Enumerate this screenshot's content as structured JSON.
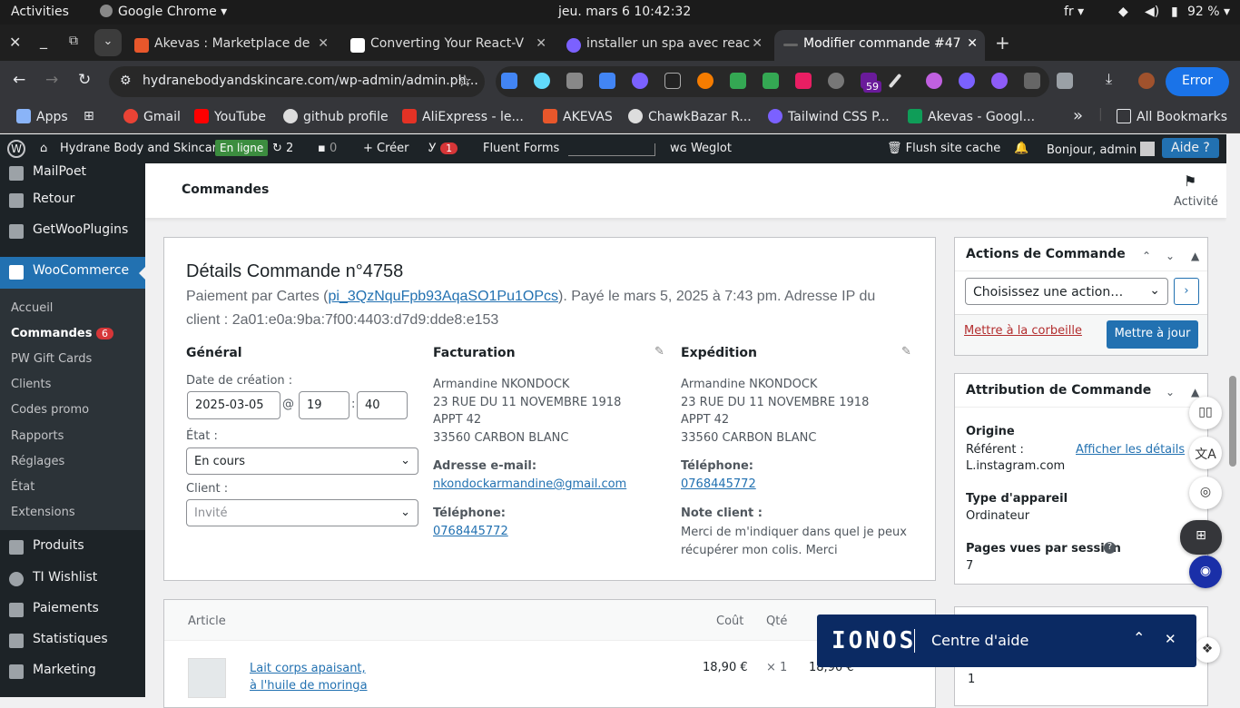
{
  "gnome": {
    "activities": "Activities",
    "app": "Google Chrome",
    "clock": "jeu. mars 6  10:42:32",
    "lang": "fr",
    "battery": "92 %"
  },
  "tabs": [
    {
      "title": "Akevas : Marketplace de",
      "color": "#e8572b"
    },
    {
      "title": "Converting Your React-V",
      "color": "#fff"
    },
    {
      "title": "installer un spa avec reac",
      "color": "#7b61ff"
    },
    {
      "title": "Modifier commande #47",
      "color": "#666"
    }
  ],
  "toolbar": {
    "url": "hydranebodyandskincare.com/wp-admin/admin.ph...",
    "ext_badge": "59",
    "error_label": "Error"
  },
  "bookmarks": [
    {
      "label": "Apps",
      "color": "#8ab4f8"
    },
    {
      "label": "Gmail",
      "color": "#ea4335"
    },
    {
      "label": "YouTube",
      "color": "#ff0000"
    },
    {
      "label": "github profile",
      "color": "#ddd"
    },
    {
      "label": "AliExpress - le...",
      "color": "#e43225"
    },
    {
      "label": "AKEVAS",
      "color": "#e8572b"
    },
    {
      "label": "ChawkBazar R...",
      "color": "#ddd"
    },
    {
      "label": "Tailwind CSS P...",
      "color": "#7b61ff"
    },
    {
      "label": "Akevas - Googl...",
      "color": "#0f9d58"
    }
  ],
  "bookmarks_more": "»",
  "all_bookmarks": "All Bookmarks",
  "wpbar": {
    "site": "Hydrane Body and Skincare",
    "online": "En ligne",
    "updates": "2",
    "comments": "0",
    "create": "Créer",
    "yoast_count": "1",
    "fluent": "Fluent Forms",
    "weglot": "Weglot",
    "flush": "Flush site cache",
    "greeting": "Bonjour, admin",
    "help": "Aide"
  },
  "sidebar": {
    "top": [
      {
        "label": "MailPoet"
      },
      {
        "label": "Retour"
      },
      {
        "label": "GetWooPlugins"
      }
    ],
    "woo": "WooCommerce",
    "sub": [
      {
        "label": "Accueil"
      },
      {
        "label": "Commandes",
        "badge": "6"
      },
      {
        "label": "PW Gift Cards"
      },
      {
        "label": "Clients"
      },
      {
        "label": "Codes promo"
      },
      {
        "label": "Rapports"
      },
      {
        "label": "Réglages"
      },
      {
        "label": "État"
      },
      {
        "label": "Extensions"
      }
    ],
    "bottom": [
      {
        "label": "Produits"
      },
      {
        "label": "TI Wishlist"
      },
      {
        "label": "Paiements"
      },
      {
        "label": "Statistiques"
      },
      {
        "label": "Marketing"
      }
    ]
  },
  "header": {
    "title": "Commandes",
    "activity": "Activité"
  },
  "order": {
    "title": "Détails Commande n°4758",
    "pay_prefix": "Paiement par Cartes (",
    "pay_id": "pi_3QzNquFpb93AqaSO1Pu1OPcs",
    "pay_suffix": "). Payé le mars 5, 2025 à 7:43 pm. Adresse IP du",
    "pay_line2": "client : 2a01:e0a:9ba:7f00:4403:d7d9:dde8:e153",
    "general": {
      "heading": "Général",
      "date_label": "Date de création :",
      "date": "2025-03-05",
      "at": "@",
      "hour": "19",
      "sep": ":",
      "minute": "40",
      "state_label": "État :",
      "state": "En cours",
      "client_label": "Client :",
      "client_placeholder": "Invité"
    },
    "billing": {
      "heading": "Facturation",
      "lines": [
        "Armandine NKONDOCK",
        "23 RUE DU 11 NOVEMBRE 1918",
        "APPT 42",
        "33560 CARBON BLANC"
      ],
      "email_label": "Adresse e-mail:",
      "email": "nkondockarmandine@gmail.com",
      "phone_label": "Téléphone:",
      "phone": "0768445772"
    },
    "shipping": {
      "heading": "Expédition",
      "lines": [
        "Armandine NKONDOCK",
        "23 RUE DU 11 NOVEMBRE 1918",
        "APPT 42",
        "33560 CARBON BLANC"
      ],
      "phone_label": "Téléphone:",
      "phone": "0768445772",
      "note_label": "Note client :",
      "note1": "Merci de m'indiquer dans quel je peux",
      "note2": "récupérer mon colis. Merci"
    }
  },
  "items": {
    "col_article": "Article",
    "col_cost": "Coût",
    "col_qty": "Qté",
    "product1": "Lait corps apaisant,",
    "product2": "à l'huile de moringa",
    "cost": "18,90 €",
    "qty": "× 1",
    "total": "18,90 €"
  },
  "actions": {
    "title": "Actions de Commande",
    "select": "Choisissez une action…",
    "trash": "Mettre à la corbeille",
    "update": "Mettre à jour"
  },
  "attribution": {
    "title": "Attribution de Commande",
    "origin_label": "Origine",
    "ref_label": "Référent :",
    "details_link": "Afficher les détails",
    "ref_value": "L.instagram.com",
    "device_label": "Type d'appareil",
    "device": "Ordinateur",
    "pages_label": "Pages vues par session",
    "pages": "7"
  },
  "third_box_value": "1",
  "ionos": {
    "logo": "IONOS",
    "title": "Centre d'aide"
  }
}
